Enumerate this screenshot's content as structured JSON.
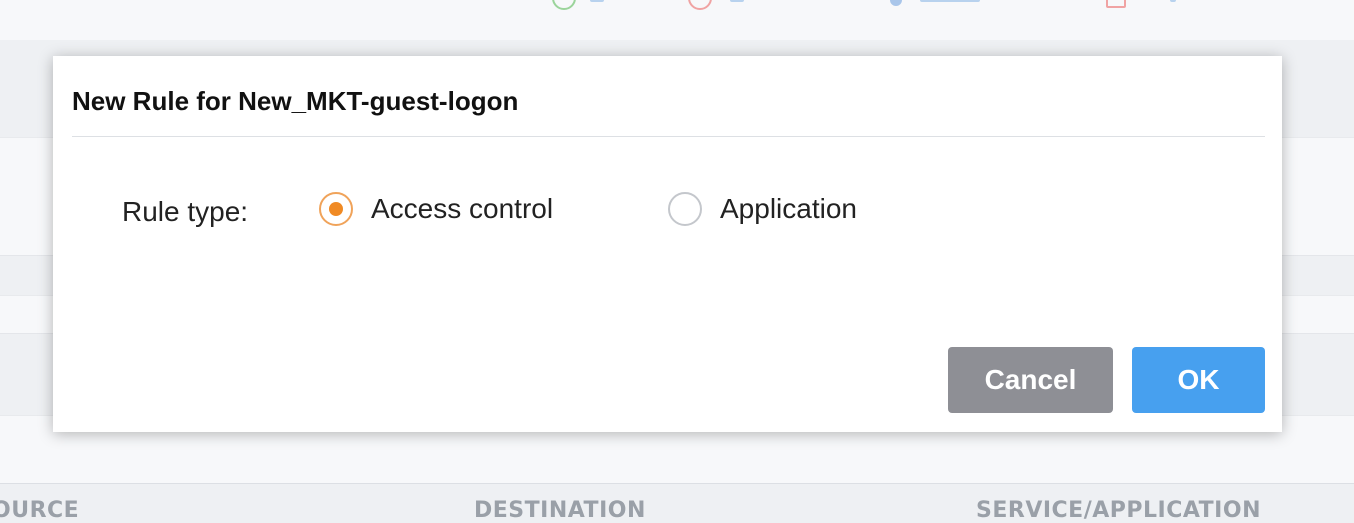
{
  "background": {
    "table_headers": [
      "OURCE",
      "DESTINATION",
      "SERVICE/APPLICATION"
    ]
  },
  "dialog": {
    "title": "New Rule for New_MKT-guest-logon",
    "rule_type_label": "Rule type:",
    "options": [
      {
        "label": "Access control",
        "selected": true
      },
      {
        "label": "Application",
        "selected": false
      }
    ],
    "buttons": {
      "cancel_label": "Cancel",
      "ok_label": "OK"
    }
  },
  "colors": {
    "accent_orange": "#f08a24",
    "ok_blue": "#47a0ef",
    "cancel_gray": "#8e8f95"
  }
}
